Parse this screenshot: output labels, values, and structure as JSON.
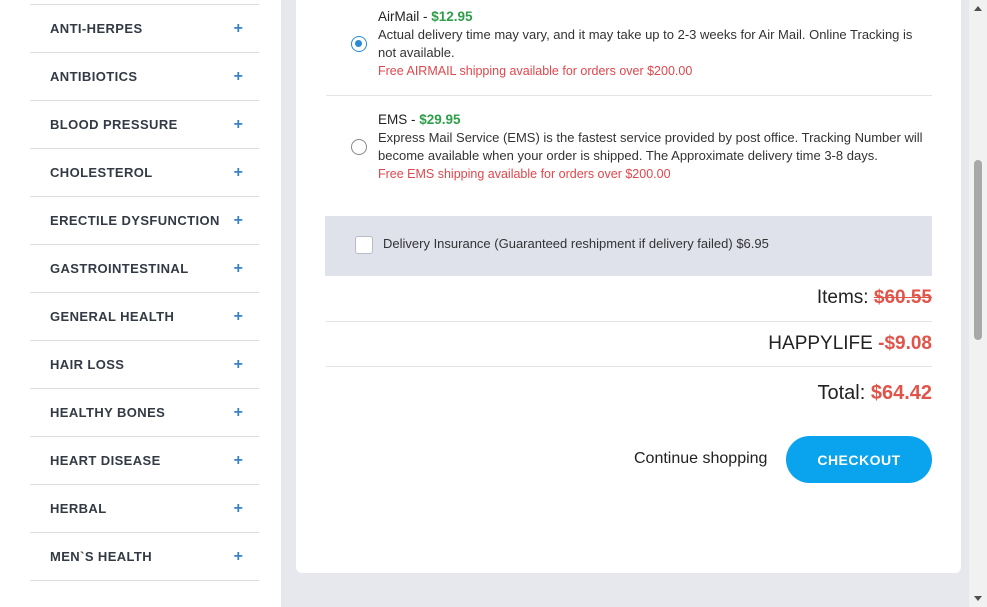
{
  "sidebar": {
    "categories": [
      {
        "label": "ANTI-HERPES"
      },
      {
        "label": "ANTIBIOTICS"
      },
      {
        "label": "BLOOD PRESSURE"
      },
      {
        "label": "CHOLESTEROL"
      },
      {
        "label": "ERECTILE DYSFUNCTION"
      },
      {
        "label": "GASTROINTESTINAL"
      },
      {
        "label": "GENERAL HEALTH"
      },
      {
        "label": "HAIR LOSS"
      },
      {
        "label": "HEALTHY BONES"
      },
      {
        "label": "HEART DISEASE"
      },
      {
        "label": "HERBAL"
      },
      {
        "label": "MEN`S HEALTH"
      }
    ],
    "expand_symbol": "+"
  },
  "shipping": {
    "airmail": {
      "name": "AirMail",
      "separator": " - ",
      "price": "$12.95",
      "description": "Actual delivery time may vary, and it may take up to 2-3 weeks for Air Mail. Online Tracking is not available.",
      "free_note": "Free AIRMAIL shipping available for orders over $200.00",
      "selected": true
    },
    "ems": {
      "name": "EMS",
      "separator": " - ",
      "price": "$29.95",
      "description": "Express Mail Service (EMS) is the fastest service provided by post office. Tracking Number will become available when your order is shipped. The Approximate delivery time 3-8 days.",
      "free_note": "Free EMS shipping available for orders over $200.00",
      "selected": false
    }
  },
  "insurance": {
    "label": "Delivery Insurance (Guaranteed reshipment if delivery failed) $6.95",
    "checked": false
  },
  "summary": {
    "items_label": "Items: ",
    "items_value": "$60.55",
    "coupon_code": "HAPPYLIFE ",
    "coupon_value": "-$9.08",
    "total_label": "Total: ",
    "total_value": "$64.42"
  },
  "actions": {
    "continue_label": "Continue shopping",
    "checkout_label": "CHECKOUT"
  },
  "colors": {
    "accent_blue": "#0aa3ee",
    "price_green": "#2e9e4a",
    "alert_red": "#e0544a"
  }
}
